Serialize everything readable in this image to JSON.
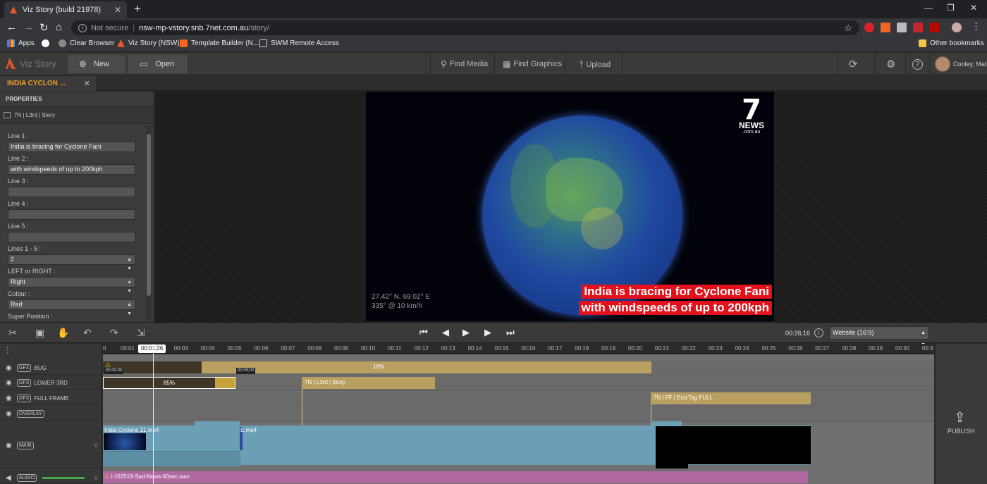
{
  "browser": {
    "tab_title": "Viz Story (build 21978)",
    "tab_close": "✕",
    "new_tab": "+",
    "url_security": "Not secure",
    "url_host": "nsw-mp-vstory.snb.7net.com.au",
    "url_path": "/story/",
    "bookmarks": [
      "Apps",
      "Clear Browser",
      "Viz Story (NSW)",
      "Template Builder (N...",
      "SWM Remote Access"
    ],
    "other_bookmarks": "Other bookmarks"
  },
  "app": {
    "logo": "Viz Story",
    "new_label": "New",
    "open_label": "Open",
    "find_media": "Find Media",
    "find_graphics": "Find Graphics",
    "upload": "Upload",
    "user": "Cooley, Mat"
  },
  "story_tab": {
    "title": "INDIA CYCLON ...",
    "close": "✕"
  },
  "properties": {
    "header": "PROPERTIES",
    "template": "7N | L3rd | Story",
    "fields": [
      {
        "label": "Line 1 :",
        "value": "India is bracing for Cyclone Fani"
      },
      {
        "label": "Line 2 :",
        "value": "with windspeeds of up to 200kph"
      },
      {
        "label": "Line 3 :",
        "value": ""
      },
      {
        "label": "Line 4 :",
        "value": ""
      },
      {
        "label": "Line 5 :",
        "value": ""
      },
      {
        "label": "Lines 1 - 5 :",
        "value": "2"
      },
      {
        "label": "LEFT or RIGHT :",
        "value": "Right"
      },
      {
        "label": "Colour :",
        "value": "Red"
      },
      {
        "label": "Super Position :",
        "value": ""
      }
    ]
  },
  "preview": {
    "logo_word": "NEWS",
    "logo_suffix": ".com.au",
    "coords_line1": "27.42° N, 69.02° E",
    "coords_line2": "335° @ 10 km/h",
    "lower_third_line1": "India is bracing for Cyclone Fani",
    "lower_third_line2": "with windspeeds of up to 200kph"
  },
  "transport": {
    "timecode": "00:26;16",
    "format": "Website (16:9)"
  },
  "timeline": {
    "playhead": "00:01;26",
    "ticks": [
      "0",
      "00:01",
      "00:02",
      "00:03",
      "00:04",
      "00:05",
      "00:06",
      "00:07",
      "00:08",
      "00:09",
      "00:10",
      "00:11",
      "00:12",
      "00:13",
      "00:14",
      "00:15",
      "00:16",
      "00:17",
      "00:18",
      "00:19",
      "00:20",
      "00:21",
      "00:22",
      "00:23",
      "00:24",
      "00:25",
      "00:26",
      "00:27",
      "00:28",
      "00:29",
      "00:30",
      "00:3"
    ],
    "tracks": {
      "bug": "BUG",
      "lower3rd": "LOWER 3RD",
      "fullframe": "FULL FRAME",
      "overlay": "OVERLAY",
      "main": "MAIN",
      "audio": "AUDIO"
    },
    "gfx_tag": "GFX",
    "bug_progress": "18%",
    "bug_in": "00:00;00",
    "bug_out": "00:05;00",
    "lower_progress": "85%",
    "lower_clip": "7N | L3rd | Story",
    "fullframe_clip": "7N | FF | End Tag FULL",
    "main_clip_1": "India Cyclone 21.mp4",
    "main_clip_2": "E.mp4",
    "audio_clip": "i-102518-Sad-News-60sec.wav",
    "progress": {
      "bug": 0.18,
      "lower": 0.85
    }
  },
  "publish": "PUBLISH",
  "colors": {
    "accent": "#f0a020",
    "lower_third": "#e3111b",
    "gfx_clip": "#b9a060",
    "main_clip": "#6a9fb5",
    "audio_clip": "#b06aa0"
  }
}
